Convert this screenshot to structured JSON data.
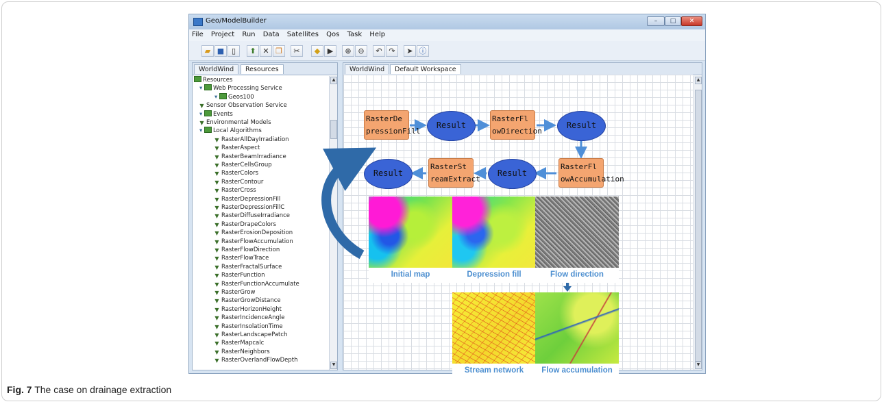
{
  "window": {
    "title": "Geo/ModelBuilder",
    "controls": {
      "minimize": "–",
      "maximize": "□",
      "close": "✕"
    }
  },
  "menu": [
    "File",
    "Project",
    "Run",
    "Data",
    "Satellites",
    "Qos",
    "Task",
    "Help"
  ],
  "toolbar_icons": [
    "open-folder-icon",
    "save-icon",
    "new-document-icon",
    "upload-icon",
    "delete-icon",
    "copy-icon",
    "cut-icon",
    "run-icon",
    "step-icon",
    "zoom-in-icon",
    "zoom-out-icon",
    "undo-icon",
    "redo-icon",
    "pointer-icon",
    "info-icon"
  ],
  "left_panel": {
    "tabs": [
      "WorldWind",
      "Resources"
    ],
    "active_tab": "Resources",
    "tree": [
      {
        "label": "Resources",
        "level": 0,
        "type": "folder"
      },
      {
        "label": "Web Processing Service",
        "level": 1,
        "type": "folder"
      },
      {
        "label": "Geos100",
        "level": 2,
        "type": "folder"
      },
      {
        "label": "Sensor Observation Service",
        "level": 1,
        "type": "leaf"
      },
      {
        "label": "Events",
        "level": 1,
        "type": "folder"
      },
      {
        "label": "Environmental Models",
        "level": 1,
        "type": "leaf"
      },
      {
        "label": "Local Algorithms",
        "level": 1,
        "type": "folder"
      },
      {
        "label": "RasterAllDayIrradiation",
        "level": 2,
        "type": "leaf"
      },
      {
        "label": "RasterAspect",
        "level": 2,
        "type": "leaf"
      },
      {
        "label": "RasterBeamIrradiance",
        "level": 2,
        "type": "leaf"
      },
      {
        "label": "RasterCellsGroup",
        "level": 2,
        "type": "leaf"
      },
      {
        "label": "RasterColors",
        "level": 2,
        "type": "leaf"
      },
      {
        "label": "RasterContour",
        "level": 2,
        "type": "leaf"
      },
      {
        "label": "RasterCross",
        "level": 2,
        "type": "leaf"
      },
      {
        "label": "RasterDepressionFill",
        "level": 2,
        "type": "leaf"
      },
      {
        "label": "RasterDepressionFillC",
        "level": 2,
        "type": "leaf"
      },
      {
        "label": "RasterDiffuseIrradiance",
        "level": 2,
        "type": "leaf"
      },
      {
        "label": "RasterDrapeColors",
        "level": 2,
        "type": "leaf"
      },
      {
        "label": "RasterErosionDeposition",
        "level": 2,
        "type": "leaf"
      },
      {
        "label": "RasterFlowAccumulation",
        "level": 2,
        "type": "leaf"
      },
      {
        "label": "RasterFlowDirection",
        "level": 2,
        "type": "leaf"
      },
      {
        "label": "RasterFlowTrace",
        "level": 2,
        "type": "leaf"
      },
      {
        "label": "RasterFractalSurface",
        "level": 2,
        "type": "leaf"
      },
      {
        "label": "RasterFunction",
        "level": 2,
        "type": "leaf"
      },
      {
        "label": "RasterFunctionAccumulate",
        "level": 2,
        "type": "leaf"
      },
      {
        "label": "RasterGrow",
        "level": 2,
        "type": "leaf"
      },
      {
        "label": "RasterGrowDistance",
        "level": 2,
        "type": "leaf"
      },
      {
        "label": "RasterHorizonHeight",
        "level": 2,
        "type": "leaf"
      },
      {
        "label": "RasterIncidenceAngle",
        "level": 2,
        "type": "leaf"
      },
      {
        "label": "RasterInsolationTime",
        "level": 2,
        "type": "leaf"
      },
      {
        "label": "RasterLandscapePatch",
        "level": 2,
        "type": "leaf"
      },
      {
        "label": "RasterMapcalc",
        "level": 2,
        "type": "leaf"
      },
      {
        "label": "RasterNeighbors",
        "level": 2,
        "type": "leaf"
      },
      {
        "label": "RasterOverlandFlowDepth",
        "level": 2,
        "type": "leaf"
      }
    ]
  },
  "workspace": {
    "tabs": [
      "WorldWind",
      "Default Workspace"
    ],
    "active_tab": "Default Workspace",
    "nodes": {
      "depression_fill": [
        "RasterDe",
        "pressionFill"
      ],
      "result_1": "Result",
      "flow_direction": [
        "RasterFl",
        "owDirection"
      ],
      "result_2": "Result",
      "flow_accumulation": [
        "RasterFl",
        "owAccumulation"
      ],
      "result_3": "Result",
      "stream_extract": [
        "RasterSt",
        "reamExtract"
      ],
      "result_4": "Result"
    },
    "images": {
      "initial_map": "Initial map",
      "depression_fill": "Depression fill",
      "flow_direction": "Flow direction",
      "flow_accumulation": "Flow accumulation",
      "stream_network": "Stream network"
    }
  },
  "colors": {
    "process_node": "#f4a570",
    "result_node": "#3a64d6",
    "arrow": "#4f8fd8",
    "label": "#4d8fd0"
  },
  "caption": {
    "prefix": "Fig. 7",
    "text": " The case on drainage extraction"
  }
}
